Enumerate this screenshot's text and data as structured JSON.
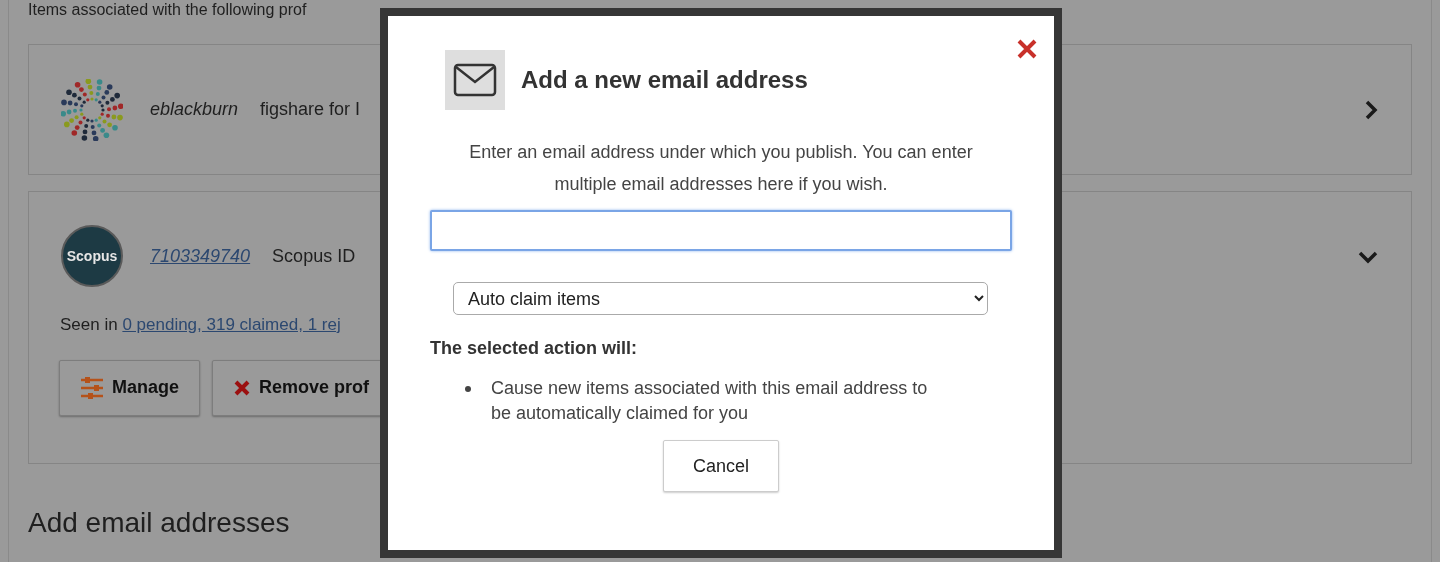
{
  "background": {
    "intro": "Items associated with the following prof",
    "profiles": [
      {
        "kind": "figshare",
        "username": "eblackburn",
        "source": "figshare for I",
        "expanded": false
      },
      {
        "kind": "scopus",
        "logo_text": "Scopus",
        "id": "7103349740",
        "source": "Scopus ID",
        "expanded": true,
        "seen_label": "Seen in",
        "seen_link": "0 pending, 319 claimed, 1 rej",
        "buttons": [
          {
            "kind": "manage",
            "label": "Manage"
          },
          {
            "kind": "remove",
            "label": "Remove prof"
          }
        ]
      }
    ],
    "heading": "Add email addresses"
  },
  "dialog": {
    "title": "Add a new email address",
    "description": "Enter an email address under which you publish. You can enter multiple email addresses here if you wish.",
    "action_select": {
      "value": "Auto claim items"
    },
    "action_heading": "The selected action will:",
    "action_effects": [
      "Cause new items associated with this email address to be automatically claimed for you"
    ],
    "cancel": "Cancel"
  }
}
